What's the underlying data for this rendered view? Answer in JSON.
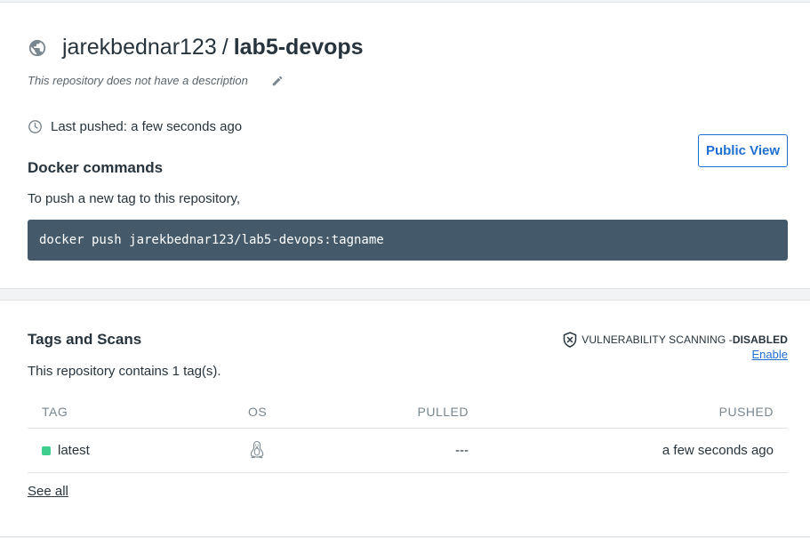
{
  "repo": {
    "owner": "jarekbednar123",
    "separator": "/",
    "name": "lab5-devops",
    "description": "This repository does not have a description",
    "last_pushed": "Last pushed: a few seconds ago",
    "icon": "globe-icon"
  },
  "actions": {
    "public_view": "Public View"
  },
  "docker_commands": {
    "title": "Docker commands",
    "push_description": "To push a new tag to this repository,",
    "command": "docker push jarekbednar123/lab5-devops:tagname"
  },
  "tags": {
    "title": "Tags and Scans",
    "count_text": "This repository contains 1 tag(s).",
    "vulnerability_label": "VULNERABILITY SCANNING - ",
    "vulnerability_status": "DISABLED",
    "enable_link": "Enable",
    "columns": [
      "TAG",
      "OS",
      "PULLED",
      "PUSHED"
    ],
    "rows": [
      {
        "tag": "latest",
        "os": "linux-icon",
        "pulled": "---",
        "pushed": "a few seconds ago",
        "status_color": "#3ecf8e"
      }
    ],
    "see_all": "See all"
  },
  "colors": {
    "accent": "#1f6fd0",
    "code_bg": "#445a6b",
    "tag_status": "#3ecf8e"
  }
}
